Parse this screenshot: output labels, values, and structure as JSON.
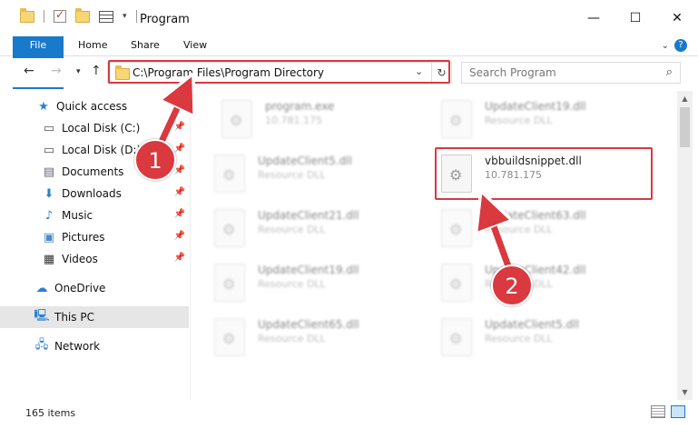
{
  "window": {
    "title": "Program"
  },
  "ribbon": {
    "tabs": [
      "File",
      "Home",
      "Share",
      "View"
    ]
  },
  "address": {
    "path": "C:\\Program Files\\Program Directory"
  },
  "search": {
    "placeholder": "Search Program"
  },
  "sidebar": {
    "items": [
      {
        "label": "Quick access",
        "icon": "star-icon",
        "pinned": false
      },
      {
        "label": "Local Disk (C:)",
        "icon": "drive-icon",
        "pinned": true
      },
      {
        "label": "Local Disk (D:)",
        "icon": "drive-icon",
        "pinned": true
      },
      {
        "label": "Documents",
        "icon": "documents-icon",
        "pinned": true
      },
      {
        "label": "Downloads",
        "icon": "downloads-icon",
        "pinned": true
      },
      {
        "label": "Music",
        "icon": "music-icon",
        "pinned": true
      },
      {
        "label": "Pictures",
        "icon": "pictures-icon",
        "pinned": true
      },
      {
        "label": "Videos",
        "icon": "videos-icon",
        "pinned": true
      },
      {
        "label": "OneDrive",
        "icon": "cloud-icon",
        "pinned": false
      },
      {
        "label": "This PC",
        "icon": "computer-icon",
        "pinned": false,
        "selected": true
      },
      {
        "label": "Network",
        "icon": "network-icon",
        "pinned": false
      }
    ]
  },
  "files": [
    {
      "name": "program.exe",
      "sub": "10.781.175",
      "blurred": true
    },
    {
      "name": "UpdateClient19.dll",
      "sub": "Resource DLL",
      "blurred": true
    },
    {
      "name": "UpdateClient5.dll",
      "sub": "Resource DLL",
      "blurred": true
    },
    {
      "name": "vbbuildsnippet.dll",
      "sub": "10.781.175",
      "blurred": false
    },
    {
      "name": "UpdateClient21.dll",
      "sub": "Resource DLL",
      "blurred": true
    },
    {
      "name": "UpdateClient63.dll",
      "sub": "Resource DLL",
      "blurred": true
    },
    {
      "name": "UpdateClient19.dll",
      "sub": "Resource DLL",
      "blurred": true
    },
    {
      "name": "UpdateClient42.dll",
      "sub": "Resource DLL",
      "blurred": true
    },
    {
      "name": "UpdateClient65.dll",
      "sub": "Resource DLL",
      "blurred": true
    },
    {
      "name": "UpdateClient5.dll",
      "sub": "Resource DLL",
      "blurred": true
    }
  ],
  "status": {
    "items_count": "165 items"
  },
  "callouts": {
    "one": "1",
    "two": "2"
  },
  "colors": {
    "accent": "#1979ca",
    "highlight": "#d9393f"
  }
}
